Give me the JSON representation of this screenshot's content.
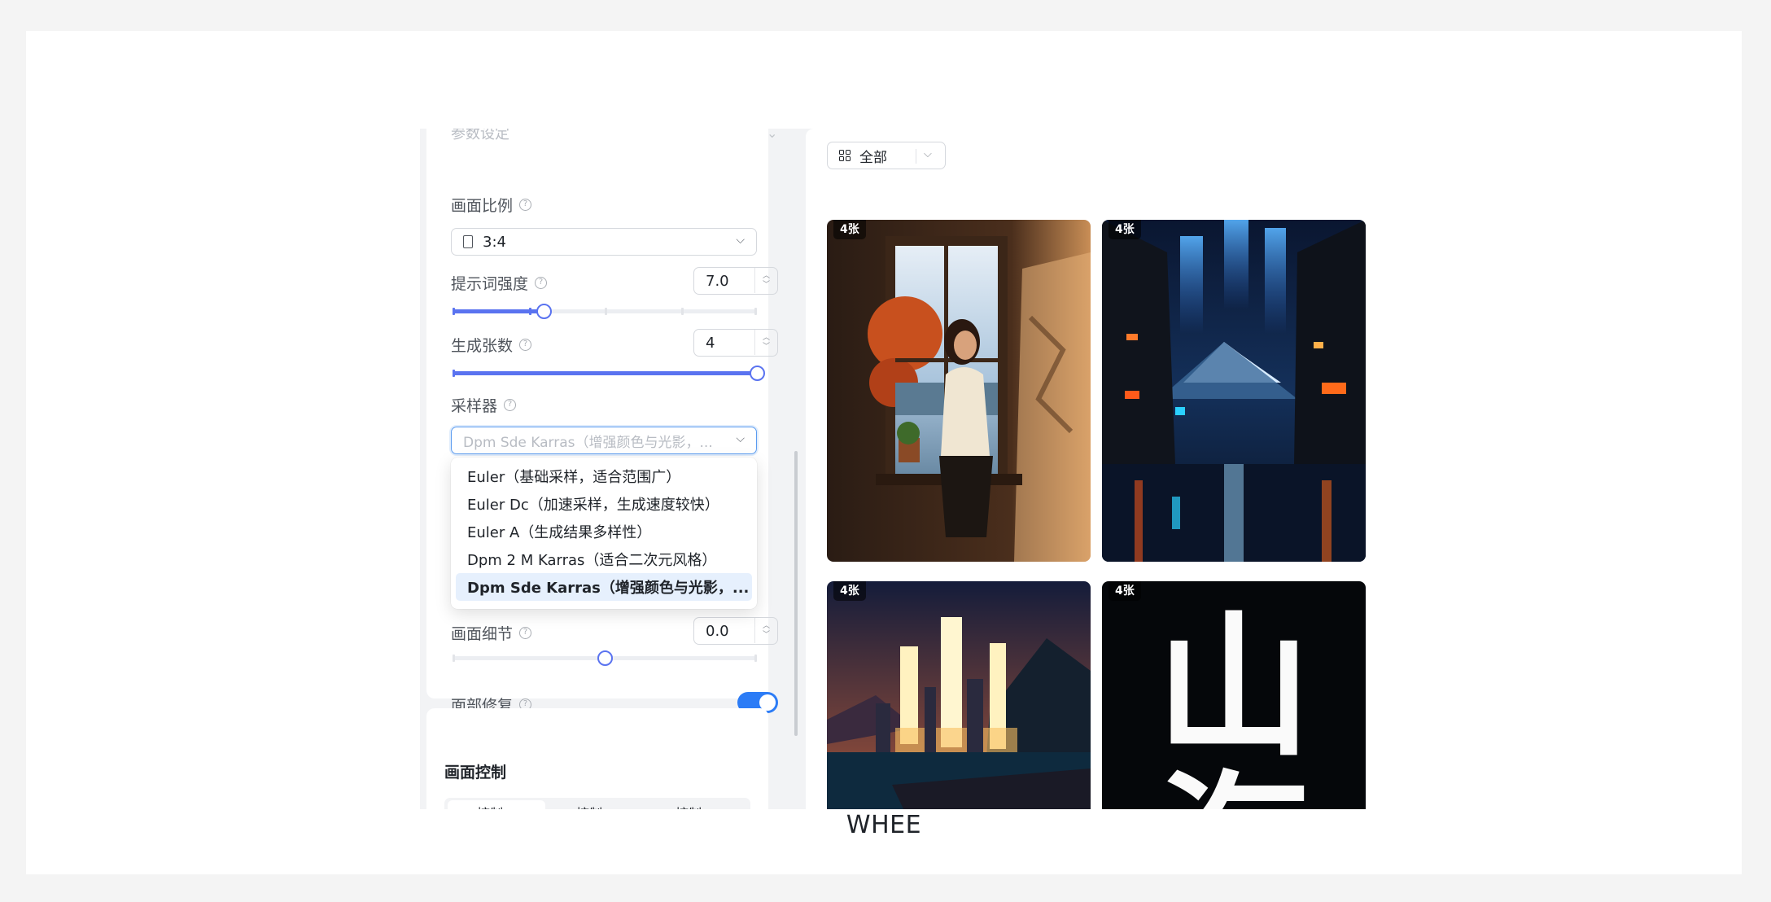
{
  "caption": "WHEE",
  "left": {
    "section_partial": "参数设定",
    "aspect": {
      "label": "画面比例",
      "value": "3:4"
    },
    "prompt_strength": {
      "label": "提示词强度",
      "value": "7.0",
      "fraction": 0.3
    },
    "count": {
      "label": "生成张数",
      "value": "4",
      "fraction": 1.0
    },
    "sampler": {
      "label": "采样器",
      "value": "Dpm Sde Karras（增强颜色与光影，...",
      "options": [
        "Euler（基础采样，适合范围广）",
        "Euler Dc（加速采样，生成速度较快）",
        "Euler A（生成结果多样性）",
        "Dpm 2 M Karras（适合二次元风格）",
        "Dpm Sde Karras（增强颜色与光影，..."
      ]
    },
    "detail": {
      "label": "画面细节",
      "value": "0.0",
      "fraction": 0.5
    },
    "face_fix": {
      "label": "面部修复",
      "enabled": true
    },
    "control": {
      "title": "画面控制",
      "tabs": [
        "控制",
        "控制",
        "控制"
      ]
    }
  },
  "right": {
    "filter_label": "全部",
    "images": [
      {
        "badge": "4张",
        "scene": "woman-window"
      },
      {
        "badge": "4张",
        "scene": "neon-street"
      },
      {
        "badge": "4张",
        "scene": "glowing-city"
      },
      {
        "badge": "4张",
        "scene": "calligraphy",
        "chars": [
          "山",
          "海"
        ]
      }
    ]
  },
  "colors": {
    "accent": "#5a73f0",
    "toggle": "#2c7cf6",
    "focus": "#5b9cf0"
  }
}
